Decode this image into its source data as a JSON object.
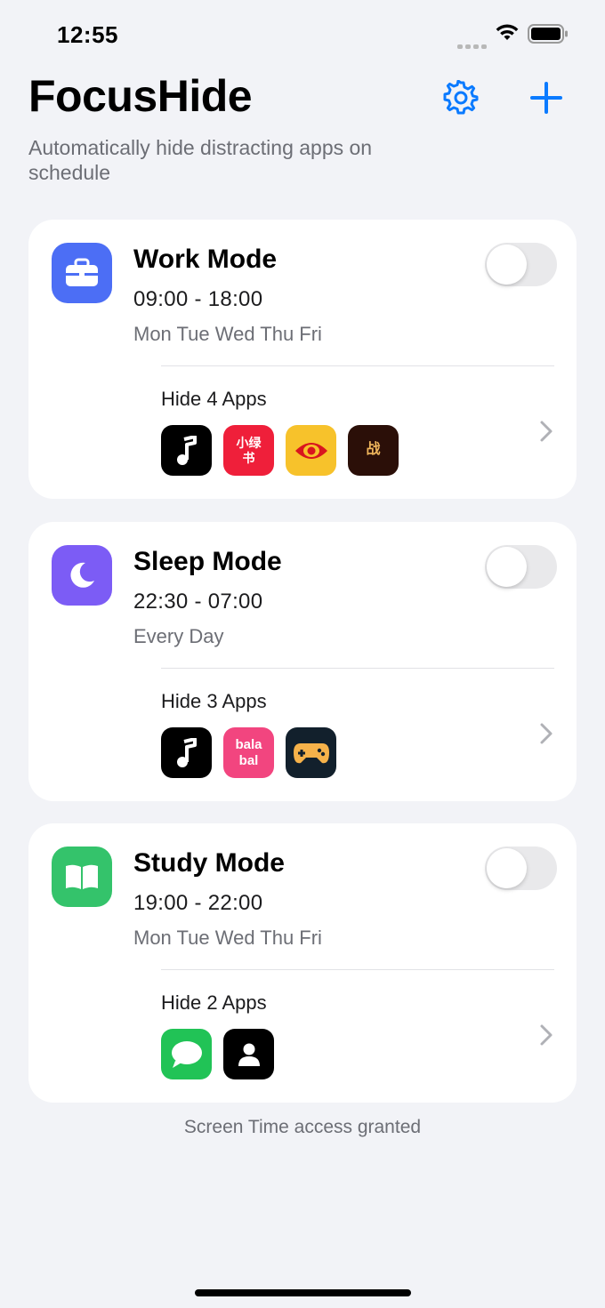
{
  "status_bar": {
    "time": "12:55"
  },
  "header": {
    "title": "FocusHide",
    "subtitle": "Automatically hide distracting apps on schedule",
    "settings_icon": "gear-icon",
    "add_icon": "plus-icon",
    "accent_color": "#0a7aff"
  },
  "modes": [
    {
      "name": "Work Mode",
      "time": "09:00 - 18:00",
      "days": "Mon Tue Wed Thu Fri",
      "icon": "briefcase-icon",
      "icon_color": "#4c6ef5",
      "enabled": false,
      "hide_label": "Hide 4 Apps",
      "apps": [
        {
          "icon": "music-note-icon",
          "bg": "#000000",
          "text": ""
        },
        {
          "icon": "xiaolvshu-icon",
          "bg": "#ef1f3a",
          "text": "小绿书"
        },
        {
          "icon": "eye-icon",
          "bg": "#f7c22b",
          "text": ""
        },
        {
          "icon": "zhan-icon",
          "bg": "#2b0f08",
          "text": "战"
        }
      ]
    },
    {
      "name": "Sleep Mode",
      "time": "22:30 - 07:00",
      "days": "Every Day",
      "icon": "moon-icon",
      "icon_color": "#7c5cf5",
      "enabled": false,
      "hide_label": "Hide 3 Apps",
      "apps": [
        {
          "icon": "music-note-icon",
          "bg": "#000000",
          "text": ""
        },
        {
          "icon": "balabal-icon",
          "bg": "#f2457f",
          "text": "bala bal"
        },
        {
          "icon": "gamepad-icon",
          "bg": "#12202c",
          "text": ""
        }
      ]
    },
    {
      "name": "Study Mode",
      "time": "19:00 - 22:00",
      "days": "Mon Tue Wed Thu Fri",
      "icon": "book-icon",
      "icon_color": "#34c36b",
      "enabled": false,
      "hide_label": "Hide 2 Apps",
      "apps": [
        {
          "icon": "message-bubble-icon",
          "bg": "#21c356",
          "text": ""
        },
        {
          "icon": "contact-person-icon",
          "bg": "#000000",
          "text": ""
        }
      ]
    }
  ],
  "footer": {
    "note": "Screen Time access granted"
  }
}
